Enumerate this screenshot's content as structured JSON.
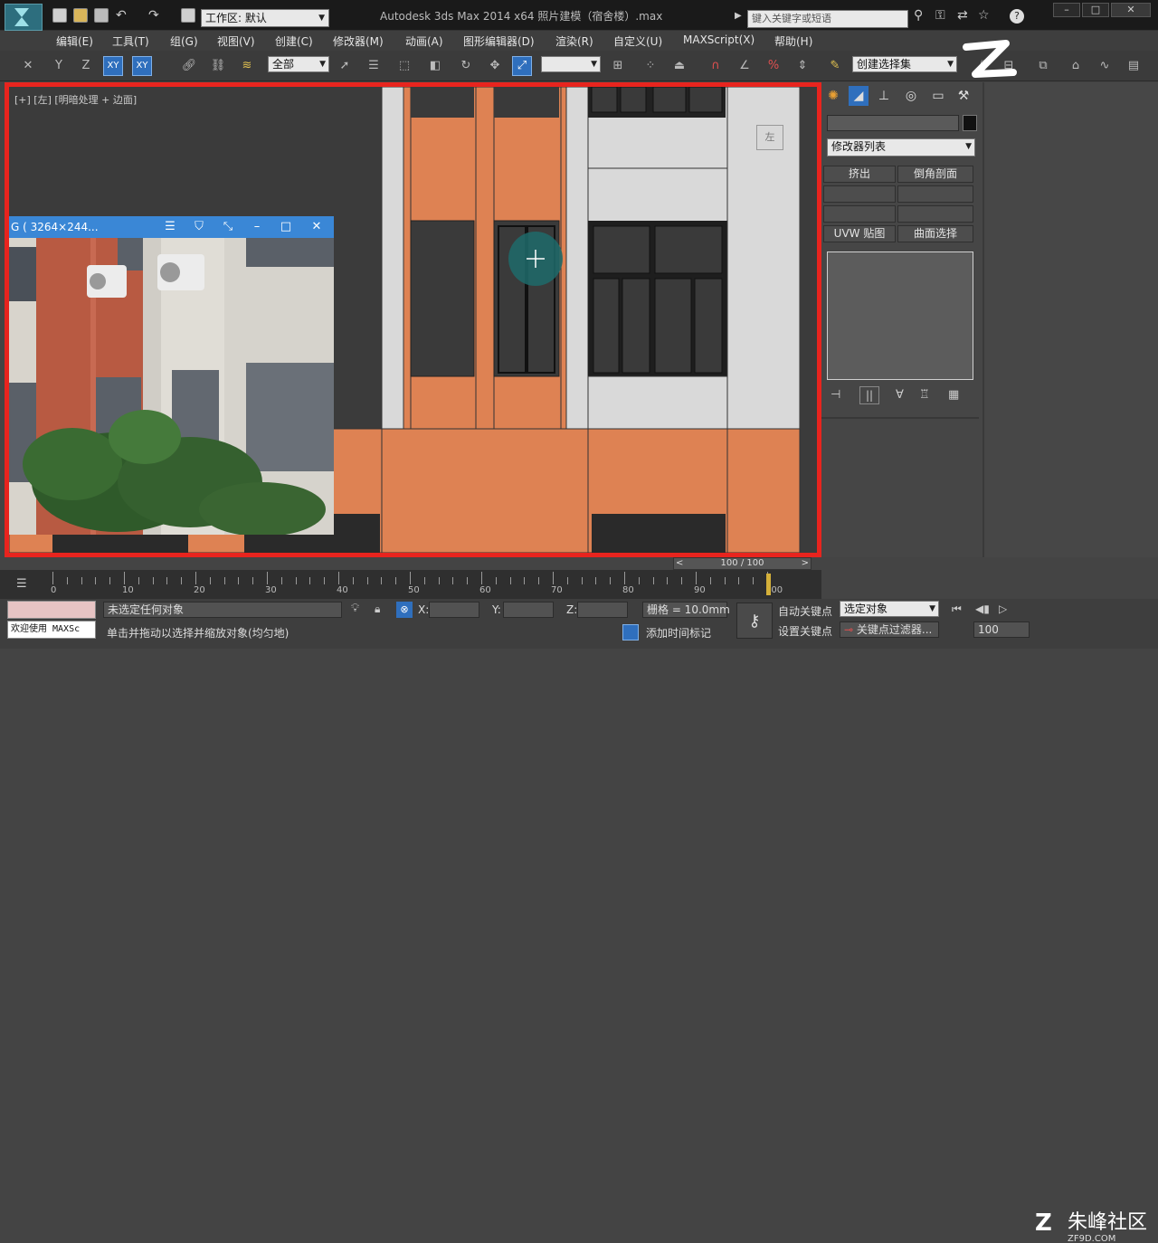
{
  "titlebar": {
    "workspace": "工作区: 默认",
    "app_title": "Autodesk 3ds Max  2014 x64      照片建模（宿舍楼）.max",
    "search_placeholder": "键入关键字或短语"
  },
  "menu": [
    "编辑(E)",
    "工具(T)",
    "组(G)",
    "视图(V)",
    "创建(C)",
    "修改器(M)",
    "动画(A)",
    "图形编辑器(D)",
    "渲染(R)",
    "自定义(U)",
    "MAXScript(X)",
    "帮助(H)"
  ],
  "toolbar": {
    "axis_xy": "XY",
    "axis_xy2": "XY",
    "filter_value": "全部",
    "selection_set": "创建选择集"
  },
  "viewport": {
    "label": "[+] [左] [明暗处理 + 边面]",
    "viewcube_label": "左"
  },
  "photo_window": {
    "title": "G ( 3264×244..."
  },
  "command_panel": {
    "modifier_list": "修改器列表",
    "buttons": [
      "挤出",
      "倒角剖面",
      "",
      "",
      "",
      "",
      "UVW 贴图",
      "曲面选择"
    ]
  },
  "timeline": {
    "slider_label": "100 / 100",
    "ticks": [
      "0",
      "10",
      "20",
      "30",
      "40",
      "50",
      "60",
      "70",
      "80",
      "90",
      "100"
    ]
  },
  "status": {
    "welcome": "欢迎使用 MAXSc",
    "selection": "未选定任何对象",
    "prompt": "单击并拖动以选择并缩放对象(均匀地)",
    "x_label": "X:",
    "y_label": "Y:",
    "z_label": "Z:",
    "grid": "栅格 = 10.0mm",
    "add_time_tag": "添加时间标记",
    "auto_key": "自动关键点",
    "set_key": "设置关键点",
    "selected_objects": "选定对象",
    "key_filters": "关键点过滤器...",
    "frame": "100"
  },
  "watermark": {
    "text": "朱峰社区",
    "url": "ZF9D.COM"
  },
  "colors": {
    "viewport_border": "#e8241e",
    "facade_orange": "#de8253",
    "accent_blue": "#2f6fbd"
  }
}
